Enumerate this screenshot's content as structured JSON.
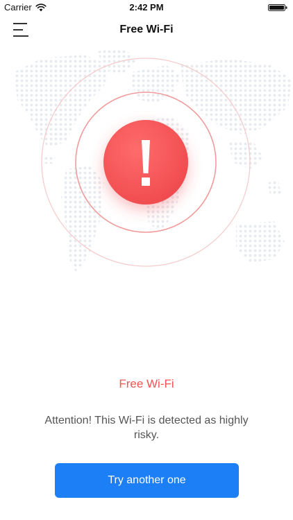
{
  "status_bar": {
    "carrier": "Carrier",
    "time": "2:42 PM",
    "wifi_icon": "wifi-icon",
    "battery_icon": "battery-icon"
  },
  "nav": {
    "title": "Free Wi-Fi",
    "menu_icon": "hamburger-menu-icon"
  },
  "alert": {
    "icon": "exclamation-icon",
    "status_label": "Free Wi-Fi",
    "message": "Attention! This Wi-Fi is detected as highly risky."
  },
  "actions": {
    "try_another_label": "Try another one"
  },
  "colors": {
    "danger": "#f05455",
    "primary_button": "#1c7ff6",
    "ring": "#f3a4a4",
    "map_dots": "#e7ebf0"
  }
}
